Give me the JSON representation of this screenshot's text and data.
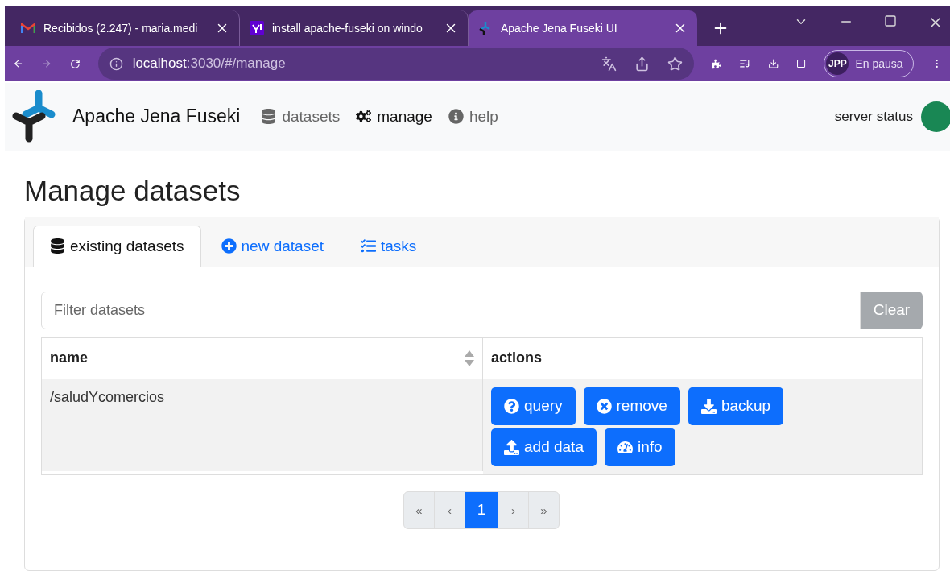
{
  "browser": {
    "tabs": [
      {
        "kind": "mail",
        "title": "Recibidos (2.247) - maria.medi",
        "selected": false
      },
      {
        "kind": "yahoo",
        "title": "install apache-fuseki on windo",
        "selected": false
      },
      {
        "kind": "jena",
        "title": "Apache Jena Fuseki UI",
        "selected": true
      }
    ],
    "address": {
      "host": "localhost",
      "path": ":3030/#/manage"
    },
    "profile": {
      "initials": "JPP",
      "label": "En pausa"
    }
  },
  "navbar": {
    "brand": "Apache Jena Fuseki",
    "items": [
      {
        "kind": "datasets",
        "label": "datasets",
        "selected": false
      },
      {
        "kind": "manage",
        "label": "manage",
        "selected": true
      },
      {
        "kind": "help",
        "label": "help",
        "selected": false
      }
    ],
    "server_status": "server status"
  },
  "page": {
    "title": "Manage datasets",
    "tabs": [
      {
        "kind": "datasets",
        "label": "existing datasets",
        "selected": true
      },
      {
        "kind": "new",
        "label": "new dataset",
        "selected": false
      },
      {
        "kind": "tasks",
        "label": "tasks",
        "selected": false
      }
    ],
    "filter": {
      "placeholder": "Filter datasets",
      "button": "Clear"
    },
    "table": {
      "columns": [
        "name",
        "actions"
      ],
      "rows": [
        {
          "name": "/saludYcomercios",
          "actions": [
            {
              "kind": "query",
              "label": "query"
            },
            {
              "kind": "remove",
              "label": "remove"
            },
            {
              "kind": "backup",
              "label": "backup"
            },
            {
              "kind": "upload",
              "label": "add data"
            },
            {
              "kind": "info",
              "label": "info"
            }
          ]
        }
      ]
    },
    "pagination": [
      {
        "label": "«",
        "selected": false
      },
      {
        "label": "‹",
        "selected": false
      },
      {
        "label": "1",
        "selected": true
      },
      {
        "label": "›",
        "selected": false
      },
      {
        "label": "»",
        "selected": false
      }
    ]
  }
}
